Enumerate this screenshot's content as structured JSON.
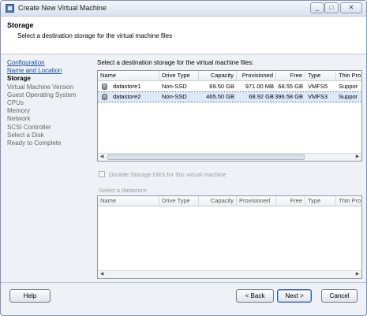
{
  "window": {
    "title": "Create New Virtual Machine",
    "controls": [
      "minimize-icon",
      "maximize-icon",
      "close-icon"
    ]
  },
  "header": {
    "title": "Storage",
    "subtitle": "Select a destination storage for the virtual machine files"
  },
  "nav": {
    "items": [
      {
        "label": "Configuration",
        "state": "done"
      },
      {
        "label": "Name and Location",
        "state": "done"
      },
      {
        "label": "Storage",
        "state": "current"
      },
      {
        "label": "Virtual Machine Version",
        "state": "pending"
      },
      {
        "label": "Guest Operating System",
        "state": "pending"
      },
      {
        "label": "CPUs",
        "state": "pending"
      },
      {
        "label": "Memory",
        "state": "pending"
      },
      {
        "label": "Network",
        "state": "pending"
      },
      {
        "label": "SCSI Controller",
        "state": "pending"
      },
      {
        "label": "Select a Disk",
        "state": "pending"
      },
      {
        "label": "Ready to Complete",
        "state": "pending"
      }
    ]
  },
  "storage": {
    "label": "Select a destination storage for the virtual machine files:",
    "columns": [
      "Name",
      "Drive Type",
      "Capacity",
      "Provisioned",
      "Free",
      "Type",
      "Thin Pro"
    ],
    "rows": [
      {
        "name": "datastore1",
        "drive_type": "Non-SSD",
        "capacity": "69.50 GB",
        "provisioned": "971.00 MB",
        "free": "68.55 GB",
        "type": "VMFS5",
        "thin": "Suppor",
        "selected": false
      },
      {
        "name": "datastore2",
        "drive_type": "Non-SSD",
        "capacity": "465.50 GB",
        "provisioned": "68.92 GB",
        "free": "396.58 GB",
        "type": "VMFS3",
        "thin": "Suppor",
        "selected": true
      }
    ]
  },
  "sdrs": {
    "checkbox_label": "Disable Storage DRS for this virtual machine",
    "checked": false
  },
  "datastore_select": {
    "label": "Select a datastore:",
    "columns": [
      "Name",
      "Drive Type",
      "Capacity",
      "Provisioned",
      "Free",
      "Type",
      "Thin Pro"
    ]
  },
  "footer": {
    "help": "Help",
    "back": "< Back",
    "next": "Next >",
    "cancel": "Cancel"
  },
  "colors": {
    "selected_row": "#dde9f7",
    "link": "#1a4fa0"
  }
}
